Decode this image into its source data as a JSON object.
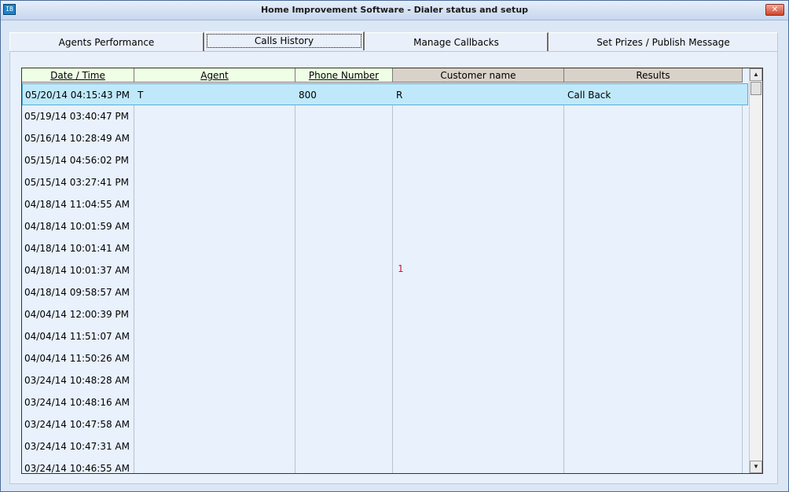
{
  "window": {
    "title": "Home Improvement Software - Dialer status and setup",
    "app_icon": "IB",
    "close_glyph": "✕"
  },
  "tabs": [
    {
      "label": "Agents Performance"
    },
    {
      "label": "Calls History",
      "active": true
    },
    {
      "label": "Manage Callbacks"
    },
    {
      "label": "Set Prizes / Publish Message"
    }
  ],
  "grid": {
    "columns": [
      {
        "label": "Date / Time",
        "sortable": true
      },
      {
        "label": "Agent",
        "sortable": true
      },
      {
        "label": "Phone Number",
        "sortable": true
      },
      {
        "label": "Customer name",
        "sortable": false
      },
      {
        "label": "Results",
        "sortable": false
      }
    ],
    "rows": [
      {
        "datetime": "05/20/14 04:15:43 PM",
        "agent": "T",
        "phone": "800",
        "customer": "R",
        "result": "Call Back",
        "selected": true
      },
      {
        "datetime": "05/19/14 03:40:47 PM"
      },
      {
        "datetime": "05/16/14 10:28:49 AM"
      },
      {
        "datetime": "05/15/14 04:56:02 PM"
      },
      {
        "datetime": "05/15/14 03:27:41 PM"
      },
      {
        "datetime": "04/18/14 11:04:55 AM"
      },
      {
        "datetime": "04/18/14 10:01:59 AM"
      },
      {
        "datetime": "04/18/14 10:01:41 AM"
      },
      {
        "datetime": "04/18/14 10:01:37 AM"
      },
      {
        "datetime": "04/18/14 09:58:57 AM"
      },
      {
        "datetime": "04/04/14 12:00:39 PM"
      },
      {
        "datetime": "04/04/14 11:51:07 AM"
      },
      {
        "datetime": "04/04/14 11:50:26 AM"
      },
      {
        "datetime": "03/24/14 10:48:28 AM"
      },
      {
        "datetime": "03/24/14 10:48:16 AM"
      },
      {
        "datetime": "03/24/14 10:47:58 AM"
      },
      {
        "datetime": "03/24/14 10:47:31 AM"
      },
      {
        "datetime": "03/24/14 10:46:55 AM"
      }
    ],
    "marker_text": "1"
  },
  "scrollbar": {
    "up_glyph": "▲",
    "down_glyph": "▼"
  }
}
